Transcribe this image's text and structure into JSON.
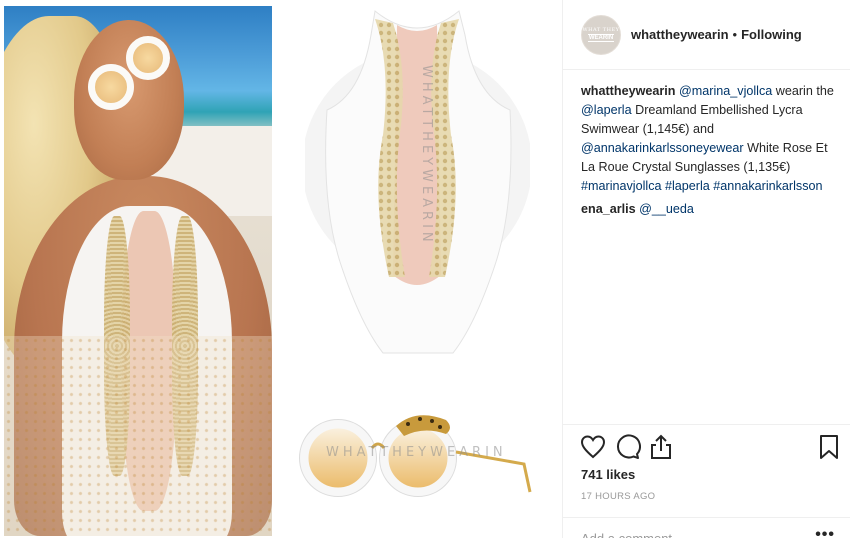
{
  "header": {
    "username": "whattheywearin",
    "separator": "•",
    "follow_status": "Following",
    "avatar_line1": "WHAT THEY",
    "avatar_line2": "WEARIN"
  },
  "caption": {
    "username": "whattheywearin",
    "mention_1": "@marina_vjollca",
    "text_1": " wearin the ",
    "mention_2": "@laperla",
    "text_2": " Dreamland Embellished Lycra Swimwear (1,145€) and ",
    "mention_3": "@annakarinkarlssoneyewear",
    "text_3": " White Rose Et La Roue Crystal Sunglasses (1,135€) ",
    "hashtags": "#marinavjollca #laperla #annakarinkarlsson"
  },
  "comment": {
    "username": "ena_arlis",
    "mention": "@__ueda"
  },
  "media": {
    "watermark_suit": "WHATTHEYWEARIN",
    "watermark_glasses": "WHATTHEYWEARIN"
  },
  "actions": {
    "icons": [
      "heart-icon",
      "comment-icon",
      "share-icon",
      "bookmark-icon"
    ],
    "likes": "741 likes",
    "timestamp": "17 HOURS AGO",
    "add_comment_placeholder": "Add a comment…",
    "more_label": "•••"
  },
  "colors": {
    "link": "#003569",
    "text": "#262626",
    "muted": "#999999",
    "divider": "#efefef"
  }
}
